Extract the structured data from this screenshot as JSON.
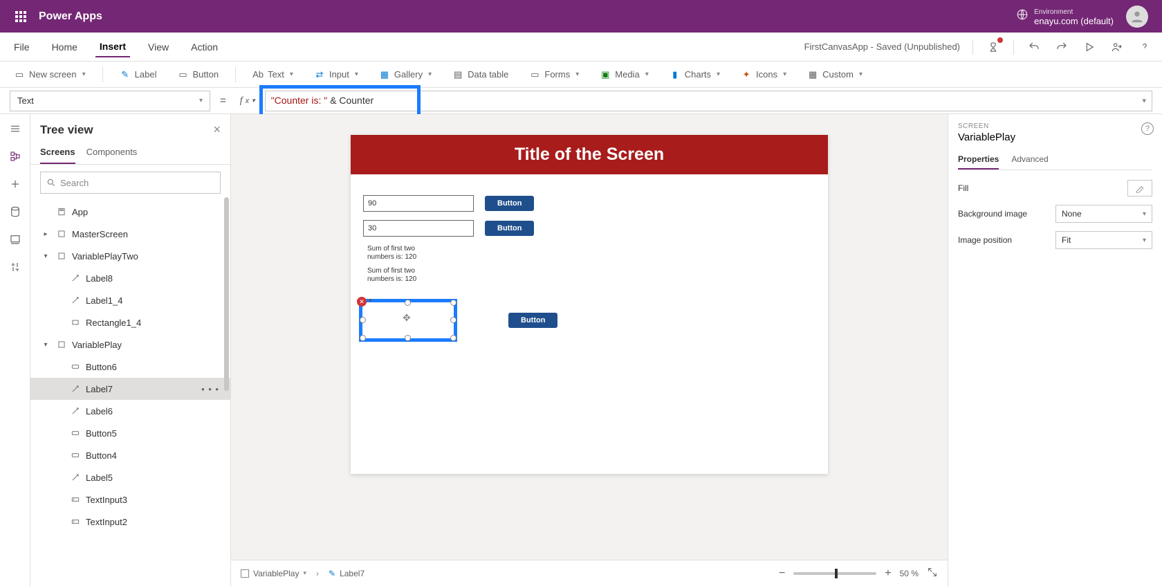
{
  "header": {
    "app_title": "Power Apps",
    "env_label": "Environment",
    "env_name": "enayu.com (default)"
  },
  "menubar": {
    "items": [
      "File",
      "Home",
      "Insert",
      "View",
      "Action"
    ],
    "active_index": 2,
    "doc_status": "FirstCanvasApp - Saved (Unpublished)"
  },
  "ribbon": {
    "items": [
      {
        "label": "New screen",
        "chev": true
      },
      {
        "sep": true
      },
      {
        "label": "Label"
      },
      {
        "label": "Button"
      },
      {
        "sep": true
      },
      {
        "label": "Text",
        "chev": true
      },
      {
        "label": "Input",
        "chev": true
      },
      {
        "label": "Gallery",
        "chev": true
      },
      {
        "label": "Data table"
      },
      {
        "label": "Forms",
        "chev": true
      },
      {
        "label": "Media",
        "chev": true
      },
      {
        "label": "Charts",
        "chev": true
      },
      {
        "label": "Icons",
        "chev": true
      },
      {
        "label": "Custom",
        "chev": true
      }
    ]
  },
  "formula": {
    "property": "Text",
    "string_part": "\"Counter is: \"",
    "op": " & ",
    "var_part": "Counter"
  },
  "tree": {
    "title": "Tree view",
    "tabs": [
      "Screens",
      "Components"
    ],
    "active_tab": 0,
    "search_placeholder": "Search",
    "nodes": [
      {
        "label": "App",
        "indent": 1,
        "icon": "app"
      },
      {
        "label": "MasterScreen",
        "indent": 1,
        "icon": "screen",
        "toggle": ">"
      },
      {
        "label": "VariablePlayTwo",
        "indent": 1,
        "icon": "screen",
        "toggle": "v"
      },
      {
        "label": "Label8",
        "indent": 2,
        "icon": "label"
      },
      {
        "label": "Label1_4",
        "indent": 2,
        "icon": "label"
      },
      {
        "label": "Rectangle1_4",
        "indent": 2,
        "icon": "rect"
      },
      {
        "label": "VariablePlay",
        "indent": 1,
        "icon": "screen",
        "toggle": "v"
      },
      {
        "label": "Button6",
        "indent": 2,
        "icon": "button"
      },
      {
        "label": "Label7",
        "indent": 2,
        "icon": "label",
        "selected": true,
        "more": true
      },
      {
        "label": "Label6",
        "indent": 2,
        "icon": "label"
      },
      {
        "label": "Button5",
        "indent": 2,
        "icon": "button"
      },
      {
        "label": "Button4",
        "indent": 2,
        "icon": "button"
      },
      {
        "label": "Label5",
        "indent": 2,
        "icon": "label"
      },
      {
        "label": "TextInput3",
        "indent": 2,
        "icon": "input"
      },
      {
        "label": "TextInput2",
        "indent": 2,
        "icon": "input"
      }
    ]
  },
  "canvas": {
    "title": "Title of the Screen",
    "input1": "90",
    "input2": "30",
    "btn": "Button",
    "sum1_l1": "Sum of first two",
    "sum1_l2": "numbers is: 120",
    "sum2_l1": "Sum of first two",
    "sum2_l2": "numbers is: 120"
  },
  "canvas_footer": {
    "crumb1": "VariablePlay",
    "crumb2": "Label7",
    "zoom": "50",
    "zoom_suffix": "%"
  },
  "props": {
    "cat": "SCREEN",
    "name": "VariablePlay",
    "tabs": [
      "Properties",
      "Advanced"
    ],
    "active_tab": 0,
    "fill_label": "Fill",
    "bg_label": "Background image",
    "bg_value": "None",
    "imgpos_label": "Image position",
    "imgpos_value": "Fit"
  }
}
